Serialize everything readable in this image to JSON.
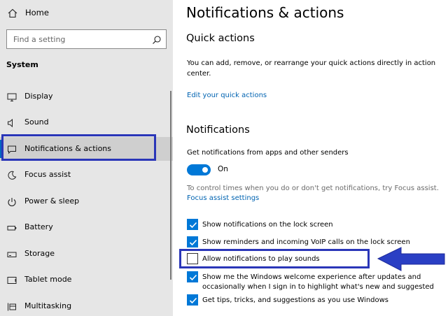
{
  "sidebar": {
    "home_label": "Home",
    "search_placeholder": "Find a setting",
    "section_title": "System",
    "items": [
      {
        "label": "Display",
        "icon": "monitor-icon"
      },
      {
        "label": "Sound",
        "icon": "speaker-icon"
      },
      {
        "label": "Notifications & actions",
        "icon": "notification-icon",
        "selected": true
      },
      {
        "label": "Focus assist",
        "icon": "moon-icon"
      },
      {
        "label": "Power & sleep",
        "icon": "power-icon"
      },
      {
        "label": "Battery",
        "icon": "battery-icon"
      },
      {
        "label": "Storage",
        "icon": "storage-icon"
      },
      {
        "label": "Tablet mode",
        "icon": "tablet-icon"
      },
      {
        "label": "Multitasking",
        "icon": "multitasking-icon"
      }
    ]
  },
  "main": {
    "title": "Notifications & actions",
    "quick_actions": {
      "heading": "Quick actions",
      "description_line1": "You can add, remove, or rearrange your quick actions directly in action",
      "description_line2": "center.",
      "edit_link": "Edit your quick actions"
    },
    "notifications": {
      "heading": "Notifications",
      "get_notifications_label": "Get notifications from apps and other senders",
      "toggle_state": "On",
      "toggle_on": true,
      "focus_text": "To control times when you do or don't get notifications, try Focus assist.",
      "focus_link": "Focus assist settings",
      "checkboxes": [
        {
          "label": "Show notifications on the lock screen",
          "checked": true
        },
        {
          "label": "Show reminders and incoming VoIP calls on the lock screen",
          "checked": true
        },
        {
          "label": "Allow notifications to play sounds",
          "checked": false
        },
        {
          "label_line1": "Show me the Windows welcome experience after updates and",
          "label_line2": "occasionally when I sign in to highlight what's new and suggested",
          "checked": true
        },
        {
          "label": "Get tips, tricks, and suggestions as you use Windows",
          "checked": true
        }
      ]
    }
  },
  "colors": {
    "accent": "#0078d7",
    "link": "#0063b1",
    "highlight": "#2a36b8",
    "arrow": "#2a3fc4"
  }
}
